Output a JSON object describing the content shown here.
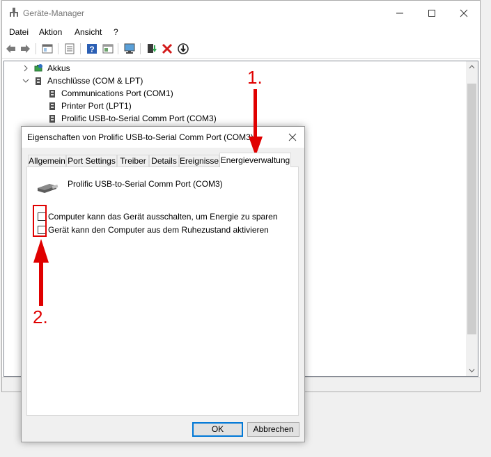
{
  "window": {
    "title": "Geräte-Manager"
  },
  "menu": [
    "Datei",
    "Aktion",
    "Ansicht",
    "?"
  ],
  "toolbar_icons": [
    "back-arrow-icon",
    "forward-arrow-icon",
    "show-hide-console-icon",
    "properties-icon",
    "help-icon",
    "device-view-icon",
    "monitor-icon",
    "update-driver-icon",
    "uninstall-icon",
    "disable-device-icon"
  ],
  "tree": {
    "items": [
      {
        "label": "Akkus",
        "expanded": false
      },
      {
        "label": "Anschlüsse (COM & LPT)",
        "expanded": true
      },
      {
        "label": "Communications Port (COM1)"
      },
      {
        "label": "Printer Port (LPT1)"
      },
      {
        "label": "Prolific USB-to-Serial Comm Port (COM3)"
      }
    ]
  },
  "dialog": {
    "title": "Eigenschaften von Prolific USB-to-Serial Comm Port (COM3)",
    "tabs": [
      "Allgemein",
      "Port Settings",
      "Treiber",
      "Details",
      "Ereignisse",
      "Energieverwaltung"
    ],
    "active_tab": "Energieverwaltung",
    "device_name": "Prolific USB-to-Serial Comm Port (COM3)",
    "options": [
      {
        "label": "Computer kann das Gerät ausschalten, um Energie zu sparen",
        "checked": false
      },
      {
        "label": "Gerät kann den Computer aus dem Ruhezustand aktivieren",
        "checked": false
      }
    ],
    "ok_label": "OK",
    "cancel_label": "Abbrechen"
  },
  "annotations": {
    "step1": "1.",
    "step2": "2.",
    "color": "#e00000"
  }
}
